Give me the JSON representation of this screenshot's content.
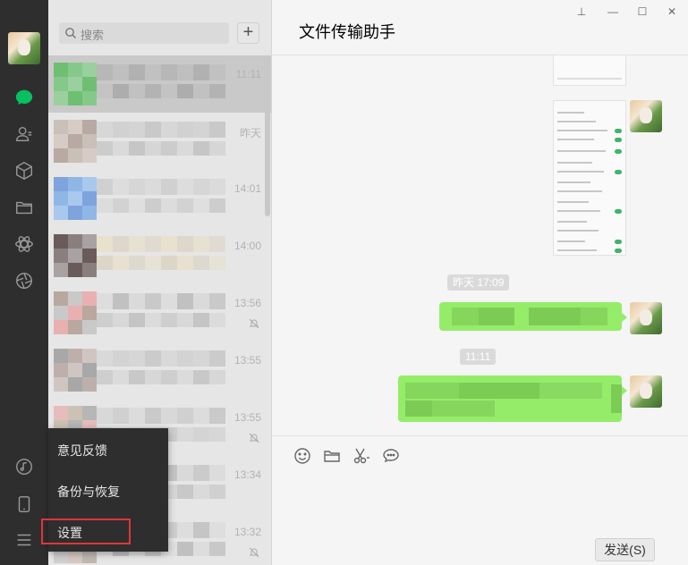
{
  "nav": {
    "items": [
      {
        "icon": "chat-icon",
        "active": true
      },
      {
        "icon": "contacts-icon"
      },
      {
        "icon": "favorites-cube-icon"
      },
      {
        "icon": "folder-icon"
      },
      {
        "icon": "mini-programs-icon"
      },
      {
        "icon": "moments-aperture-icon"
      }
    ],
    "bottom": [
      {
        "icon": "music-icon"
      },
      {
        "icon": "phone-icon"
      },
      {
        "icon": "menu-icon"
      }
    ]
  },
  "search": {
    "placeholder": "搜索"
  },
  "add_button": "+",
  "chats": [
    {
      "time": "11:11",
      "muted": false,
      "active": true
    },
    {
      "time": "昨天",
      "muted": false
    },
    {
      "time": "14:01",
      "muted": false
    },
    {
      "time": "14:00",
      "muted": false
    },
    {
      "time": "13:56",
      "muted": true
    },
    {
      "time": "13:55",
      "muted": false
    },
    {
      "time": "13:55",
      "muted": true
    },
    {
      "time": "13:34",
      "muted": false
    },
    {
      "time": "13:32",
      "muted": true
    }
  ],
  "window_controls": {
    "pin": "⊥",
    "minimize": "—",
    "maximize": "☐",
    "close": "✕"
  },
  "chat": {
    "title": "文件传输助手",
    "timestamps": [
      "昨天 17:09",
      "11:11"
    ]
  },
  "composer": {
    "tools": [
      "emoji-icon",
      "folder-icon",
      "scissors-icon",
      "chat-bubble-icon"
    ],
    "send_label": "发送(S)"
  },
  "menu": {
    "items": [
      "意见反馈",
      "备份与恢复",
      "设置"
    ]
  },
  "colors": {
    "nav_bg": "#2e2e2e",
    "list_bg": "#e6e6e6",
    "bubble": "#95ec69",
    "accent": "#07c160",
    "highlight": "#e0353b"
  }
}
